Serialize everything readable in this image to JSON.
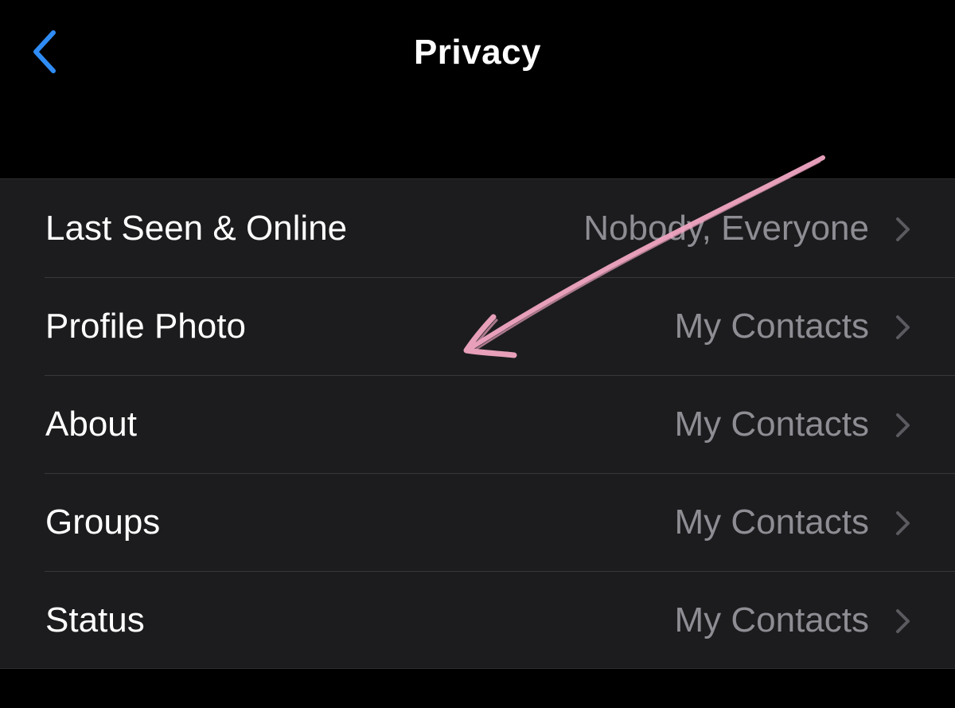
{
  "header": {
    "title": "Privacy",
    "back_icon": "chevron-left-icon"
  },
  "privacy_settings": [
    {
      "label": "Last Seen & Online",
      "value": "Nobody, Everyone"
    },
    {
      "label": "Profile Photo",
      "value": "My Contacts"
    },
    {
      "label": "About",
      "value": "My Contacts"
    },
    {
      "label": "Groups",
      "value": "My Contacts"
    },
    {
      "label": "Status",
      "value": "My Contacts"
    }
  ],
  "colors": {
    "background": "#000000",
    "group_background": "#1c1c1e",
    "accent": "#2f8cf5",
    "secondary_text": "#8d8d93",
    "chevron": "#5a5a5f",
    "annotation": "#f2a7c3"
  },
  "annotation": {
    "icon": "hand-drawn-arrow-icon"
  }
}
